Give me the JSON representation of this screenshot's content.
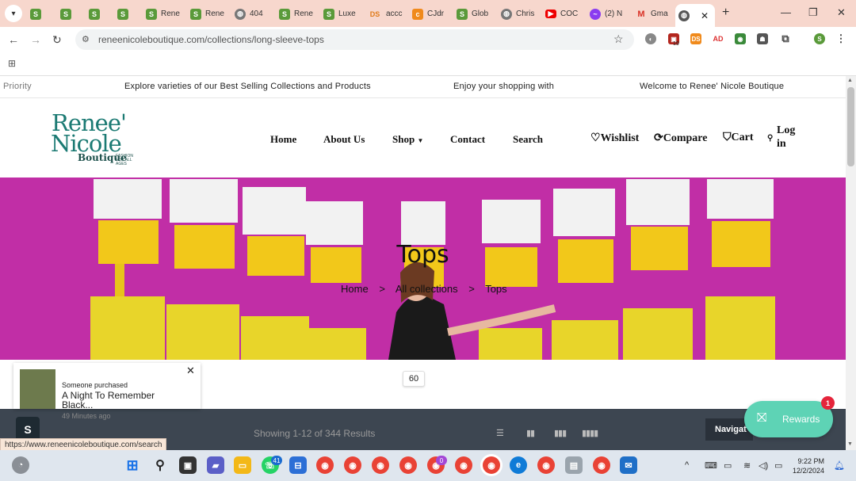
{
  "browser": {
    "tabs": [
      {
        "label": "",
        "fav": "shopify-icon"
      },
      {
        "label": "",
        "fav": "shopify-icon"
      },
      {
        "label": "",
        "fav": "shopify-icon"
      },
      {
        "label": "",
        "fav": "shopify-icon"
      },
      {
        "label": "Rene",
        "fav": "shopify-icon"
      },
      {
        "label": "Rene",
        "fav": "shopify-icon"
      },
      {
        "label": "404",
        "fav": "globe-icon"
      },
      {
        "label": "Rene",
        "fav": "shopify-icon"
      },
      {
        "label": "Luxe",
        "fav": "shopify-icon"
      },
      {
        "label": "accc",
        "fav": "ds-icon"
      },
      {
        "label": "CJdr",
        "fav": "cj-icon"
      },
      {
        "label": "Glob",
        "fav": "shopify-icon"
      },
      {
        "label": "Chris",
        "fav": "globe-icon"
      },
      {
        "label": "COC",
        "fav": "youtube-icon"
      },
      {
        "label": "(2) N",
        "fav": "messenger-icon"
      },
      {
        "label": "Gma",
        "fav": "gmail-icon"
      },
      {
        "label": "",
        "fav": "globe-icon"
      }
    ],
    "url": "reneenicoleboutique.com/collections/long-sleeve-tops",
    "ext_badge": "19",
    "status_url": "https://www.reneenicoleboutique.com/search"
  },
  "marquee": {
    "items": [
      "Priority",
      "Explore varieties of our Best Selling Collections and Products",
      "Enjoy your shopping with",
      "Welcome to Renee' Nicole Boutique"
    ]
  },
  "logo": {
    "line1": "Renee'",
    "line2": "Nicole",
    "line3": "Boutique",
    "tagline": "FASHION FOR ALL AGES"
  },
  "nav": {
    "home": "Home",
    "about": "About Us",
    "shop": "Shop",
    "contact": "Contact",
    "search": "Search"
  },
  "utility": {
    "wishlist": "Wishlist",
    "compare": "Compare",
    "cart": "Cart",
    "login_line1": "Log",
    "login_line2": "in"
  },
  "hero": {
    "title": "Tops",
    "breadcrumb": [
      "Home",
      "All collections",
      "Tops"
    ],
    "separator": ">"
  },
  "count_badge": "60",
  "results": {
    "text": "Showing 1-12 of 344 Results",
    "navigate": "Navigat"
  },
  "popup": {
    "who": "Someone purchased",
    "product": "A Night To Remember Black...",
    "time": "49 Minutes ago"
  },
  "rewards": {
    "label": "Rewards",
    "badge": "1"
  },
  "taskbar": {
    "whatsapp_badge": "41",
    "chrome_badge": "0",
    "time": "9:22 PM",
    "date": "12/2/2024"
  },
  "colors": {
    "brand": "#1b7a73",
    "hero_bg": "#c12ea6",
    "rewards": "#5ed3b5",
    "results_bar": "#3d4651"
  }
}
